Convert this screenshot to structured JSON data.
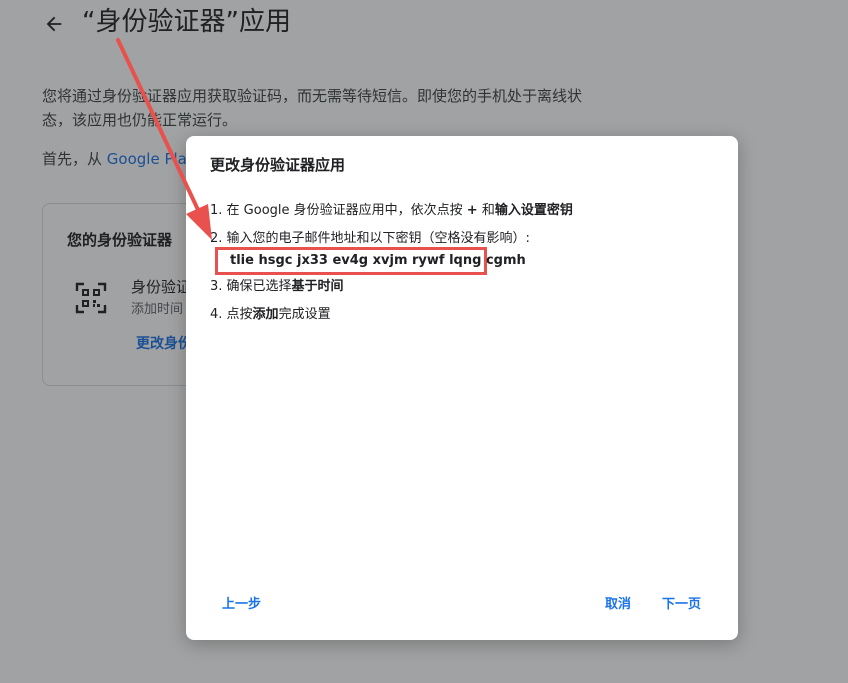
{
  "page": {
    "title": "“身份验证器”应用",
    "intro": "您将通过身份验证器应用获取验证码，而无需等待短信。即使您的手机处于离线状态，该应用也仍能正常运行。",
    "first_prefix": "首先，从 ",
    "first_link": "Google Play",
    "card": {
      "title": "您的身份验证器",
      "app_name": "身份验证器",
      "added": "添加时间",
      "change_link": "更改身份验证器应用"
    }
  },
  "dialog": {
    "title": "更改身份验证器应用",
    "step1": {
      "prefix": "1. 在 Google 身份验证器应用中，依次点按 ",
      "plus": "+",
      "and": " 和",
      "bold": "输入设置密钥"
    },
    "step2": {
      "text": "2. 输入您的电子邮件地址和以下密钥（空格没有影响）:"
    },
    "secret_key": "tlie hsgc jx33 ev4g xvjm rywf lqng cgmh",
    "step3": {
      "prefix": "3. 确保已选择",
      "bold": "基于时间"
    },
    "step4": {
      "prefix": "4. 点按",
      "bold": "添加",
      "suffix": "完成设置"
    },
    "buttons": {
      "prev": "上一步",
      "cancel": "取消",
      "next": "下一页"
    }
  },
  "colors": {
    "accent": "#1a73e8",
    "annotation": "#e8514d"
  }
}
